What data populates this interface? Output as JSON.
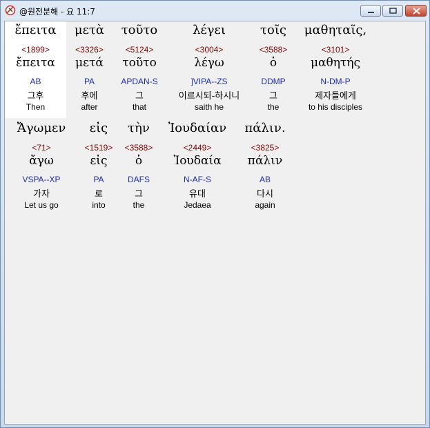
{
  "window": {
    "title": "@원전분해 - 요 11:7",
    "icon": "app-logo-icon",
    "controls": [
      "minimize-icon",
      "maximize-icon",
      "close-icon"
    ],
    "close_color": "#c0442e"
  },
  "colors": {
    "strong_number": "#8b0000",
    "morphology": "#1e2fb4",
    "background": "#f0f0f0",
    "selected": "#ffffff"
  },
  "lines": [
    {
      "words": [
        {
          "greek": "ἔπειτα",
          "strong": "<1899>",
          "lemma": "ἔπειτα",
          "morph": "AB",
          "korean": "그후",
          "english": "Then",
          "selected": true
        },
        {
          "greek": "μετὰ",
          "strong": "<3326>",
          "lemma": "μετά",
          "morph": "PA",
          "korean": "후에",
          "english": "after"
        },
        {
          "greek": "τοῦτο",
          "strong": "<5124>",
          "lemma": "τοῦτο",
          "morph": "APDAN-S",
          "korean": "그",
          "english": "that"
        },
        {
          "greek": "λέγει",
          "strong": "<3004>",
          "lemma": "λέγω",
          "morph": "]VIPA--ZS",
          "korean": "이르시되-하시니",
          "english": "saith he"
        },
        {
          "greek": "τοῖς",
          "strong": "<3588>",
          "lemma": "ὁ",
          "morph": "DDMP",
          "korean": "그",
          "english": "the"
        },
        {
          "greek": "μαθηταῖς,",
          "strong": "<3101>",
          "lemma": "μαθητής",
          "morph": "N-DM-P",
          "korean": "제자들에게",
          "english": "to his disciples"
        }
      ]
    },
    {
      "words": [
        {
          "greek": "Ἄγωμεν",
          "strong": "<71>",
          "lemma": "ἄγω",
          "morph": "VSPA--XP",
          "korean": "가자",
          "english": "Let us go"
        },
        {
          "greek": "εἰς",
          "strong": "<1519>",
          "lemma": "εἰς",
          "morph": "PA",
          "korean": "로",
          "english": "into"
        },
        {
          "greek": "τὴν",
          "strong": "<3588>",
          "lemma": "ὁ",
          "morph": "DAFS",
          "korean": "그",
          "english": "the"
        },
        {
          "greek": "Ἰουδαίαν",
          "strong": "<2449>",
          "lemma": "Ἰουδαία",
          "morph": "N-AF-S",
          "korean": "유대",
          "english": "Jedaea"
        },
        {
          "greek": "πάλιν.",
          "strong": "<3825>",
          "lemma": "πάλιν",
          "morph": "AB",
          "korean": "다시",
          "english": "again"
        }
      ]
    }
  ]
}
